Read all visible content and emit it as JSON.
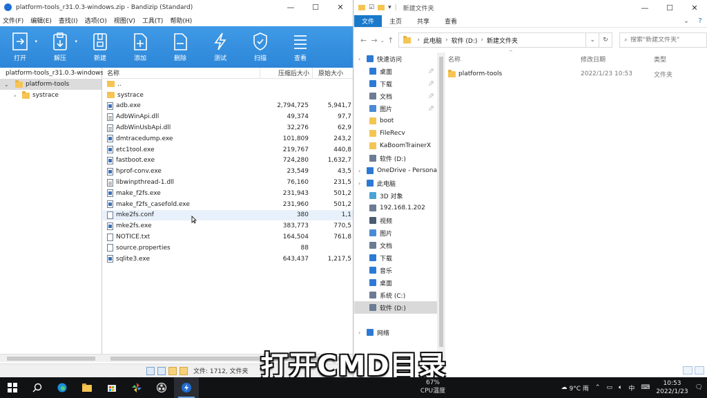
{
  "bandizip": {
    "title": "platform-tools_r31.0.3-windows.zip - Bandizip (Standard)",
    "window_buttons": [
      "—",
      "☐",
      "✕"
    ],
    "menu": [
      "文件(F)",
      "编辑(E)",
      "查找(I)",
      "选项(O)",
      "视图(V)",
      "工具(T)",
      "帮助(H)"
    ],
    "toolbar": [
      {
        "label": "打开",
        "icon": "open-icon",
        "dropdown": true
      },
      {
        "label": "解压",
        "icon": "extract-icon",
        "dropdown": true
      },
      {
        "label": "新建",
        "icon": "new-archive-icon",
        "dropdown": false
      },
      {
        "label": "添加",
        "icon": "add-file-icon",
        "dropdown": false
      },
      {
        "label": "删除",
        "icon": "delete-file-icon",
        "dropdown": false
      },
      {
        "label": "测试",
        "icon": "test-bolt-icon",
        "dropdown": false
      },
      {
        "label": "扫描",
        "icon": "scan-shield-icon",
        "dropdown": false
      },
      {
        "label": "查看",
        "icon": "view-list-icon",
        "dropdown": false
      }
    ],
    "tree": {
      "root": "platform-tools_r31.0.3-windows.zip",
      "folder": "platform-tools",
      "subfolder": "systrace"
    },
    "columns": {
      "name": "名称",
      "compressed": "压缩后大小",
      "original": "原始大小"
    },
    "files": [
      {
        "name": "..",
        "type": "folder",
        "compressed": "",
        "original": ""
      },
      {
        "name": "systrace",
        "type": "folder",
        "compressed": "",
        "original": ""
      },
      {
        "name": "adb.exe",
        "type": "exe",
        "compressed": "2,794,725",
        "original": "5,941,7"
      },
      {
        "name": "AdbWinApi.dll",
        "type": "dll",
        "compressed": "49,374",
        "original": "97,7"
      },
      {
        "name": "AdbWinUsbApi.dll",
        "type": "dll",
        "compressed": "32,276",
        "original": "62,9"
      },
      {
        "name": "dmtracedump.exe",
        "type": "exe",
        "compressed": "101,809",
        "original": "243,2"
      },
      {
        "name": "etc1tool.exe",
        "type": "exe",
        "compressed": "219,767",
        "original": "440,8"
      },
      {
        "name": "fastboot.exe",
        "type": "exe",
        "compressed": "724,280",
        "original": "1,632,7"
      },
      {
        "name": "hprof-conv.exe",
        "type": "exe",
        "compressed": "23,549",
        "original": "43,5"
      },
      {
        "name": "libwinpthread-1.dll",
        "type": "dll",
        "compressed": "76,160",
        "original": "231,5"
      },
      {
        "name": "make_f2fs.exe",
        "type": "exe",
        "compressed": "231,943",
        "original": "501,2"
      },
      {
        "name": "make_f2fs_casefold.exe",
        "type": "exe",
        "compressed": "231,960",
        "original": "501,2"
      },
      {
        "name": "mke2fs.conf",
        "type": "txt",
        "compressed": "380",
        "original": "1,1"
      },
      {
        "name": "mke2fs.exe",
        "type": "exe",
        "compressed": "383,773",
        "original": "770,5"
      },
      {
        "name": "NOTICE.txt",
        "type": "txt",
        "compressed": "164,504",
        "original": "761,8"
      },
      {
        "name": "source.properties",
        "type": "txt",
        "compressed": "88",
        "original": ""
      },
      {
        "name": "sqlite3.exe",
        "type": "exe",
        "compressed": "643,437",
        "original": "1,217,5"
      }
    ],
    "status": "文件: 1712, 文件夹"
  },
  "explorer": {
    "title": "新建文件夹",
    "window_buttons": [
      "—",
      "☐",
      "✕"
    ],
    "ribbon": {
      "file": "文件",
      "tabs": [
        "主页",
        "共享",
        "查看"
      ]
    },
    "address": [
      "此电脑",
      "软件 (D:)",
      "新建文件夹"
    ],
    "search_placeholder": "搜索\"新建文件夹\"",
    "nav": [
      {
        "label": "快速访问",
        "icon": "star-icon",
        "color": "#2d7ad6",
        "level": 0,
        "pin": false
      },
      {
        "label": "桌面",
        "icon": "desktop-icon",
        "color": "#2d7ad6",
        "level": 1,
        "pin": true
      },
      {
        "label": "下载",
        "icon": "download-icon",
        "color": "#2d7ad6",
        "level": 1,
        "pin": true
      },
      {
        "label": "文档",
        "icon": "document-icon",
        "color": "#6b7c93",
        "level": 1,
        "pin": true
      },
      {
        "label": "图片",
        "icon": "picture-icon",
        "color": "#4a8ad6",
        "level": 1,
        "pin": true
      },
      {
        "label": "boot",
        "icon": "folder-icon",
        "color": "#f6c453",
        "level": 1,
        "pin": false
      },
      {
        "label": "FileRecv",
        "icon": "folder-icon",
        "color": "#f6c453",
        "level": 1,
        "pin": false
      },
      {
        "label": "KaBoomTrainerX",
        "icon": "folder-icon",
        "color": "#f6c453",
        "level": 1,
        "pin": false
      },
      {
        "label": "软件 (D:)",
        "icon": "drive-icon",
        "color": "#6b7c93",
        "level": 1,
        "pin": false
      },
      {
        "label": "OneDrive - Persona",
        "icon": "cloud-icon",
        "color": "#2d7ad6",
        "level": 0,
        "pin": false
      },
      {
        "label": "此电脑",
        "icon": "computer-icon",
        "color": "#2d7ad6",
        "level": 0,
        "pin": false
      },
      {
        "label": "3D 对象",
        "icon": "cube-icon",
        "color": "#4aa3d6",
        "level": 1,
        "pin": false
      },
      {
        "label": "192.168.1.202",
        "icon": "network-drive-icon",
        "color": "#6b7c93",
        "level": 1,
        "pin": false
      },
      {
        "label": "视频",
        "icon": "video-icon",
        "color": "#4a5a70",
        "level": 1,
        "pin": false
      },
      {
        "label": "图片",
        "icon": "picture-icon",
        "color": "#4a8ad6",
        "level": 1,
        "pin": false
      },
      {
        "label": "文档",
        "icon": "document-icon",
        "color": "#6b7c93",
        "level": 1,
        "pin": false
      },
      {
        "label": "下载",
        "icon": "download-icon",
        "color": "#2d7ad6",
        "level": 1,
        "pin": false
      },
      {
        "label": "音乐",
        "icon": "music-icon",
        "color": "#2d7ad6",
        "level": 1,
        "pin": false
      },
      {
        "label": "桌面",
        "icon": "desktop-icon",
        "color": "#2d7ad6",
        "level": 1,
        "pin": false
      },
      {
        "label": "系统 (C:)",
        "icon": "drive-icon",
        "color": "#6b7c93",
        "level": 1,
        "pin": false
      },
      {
        "label": "软件 (D:)",
        "icon": "drive-icon",
        "color": "#6b7c93",
        "level": 1,
        "pin": false,
        "selected": true
      },
      {
        "label": "",
        "icon": "",
        "color": "",
        "level": 1,
        "pin": false
      },
      {
        "label": "网络",
        "icon": "network-icon",
        "color": "#2d7ad6",
        "level": 0,
        "pin": false
      }
    ],
    "columns": {
      "name": "名称",
      "date": "修改日期",
      "type": "类型"
    },
    "items": [
      {
        "name": "platform-tools",
        "date": "2022/1/23 10:53",
        "type": "文件夹"
      }
    ]
  },
  "subtitle": "打开CMD目录",
  "taskbar": {
    "cpu_percent": "67%",
    "cpu_label": "CPU温度",
    "weather": "9°C 雨",
    "ime": "中",
    "time": "10:53",
    "date": "2022/1/23"
  }
}
